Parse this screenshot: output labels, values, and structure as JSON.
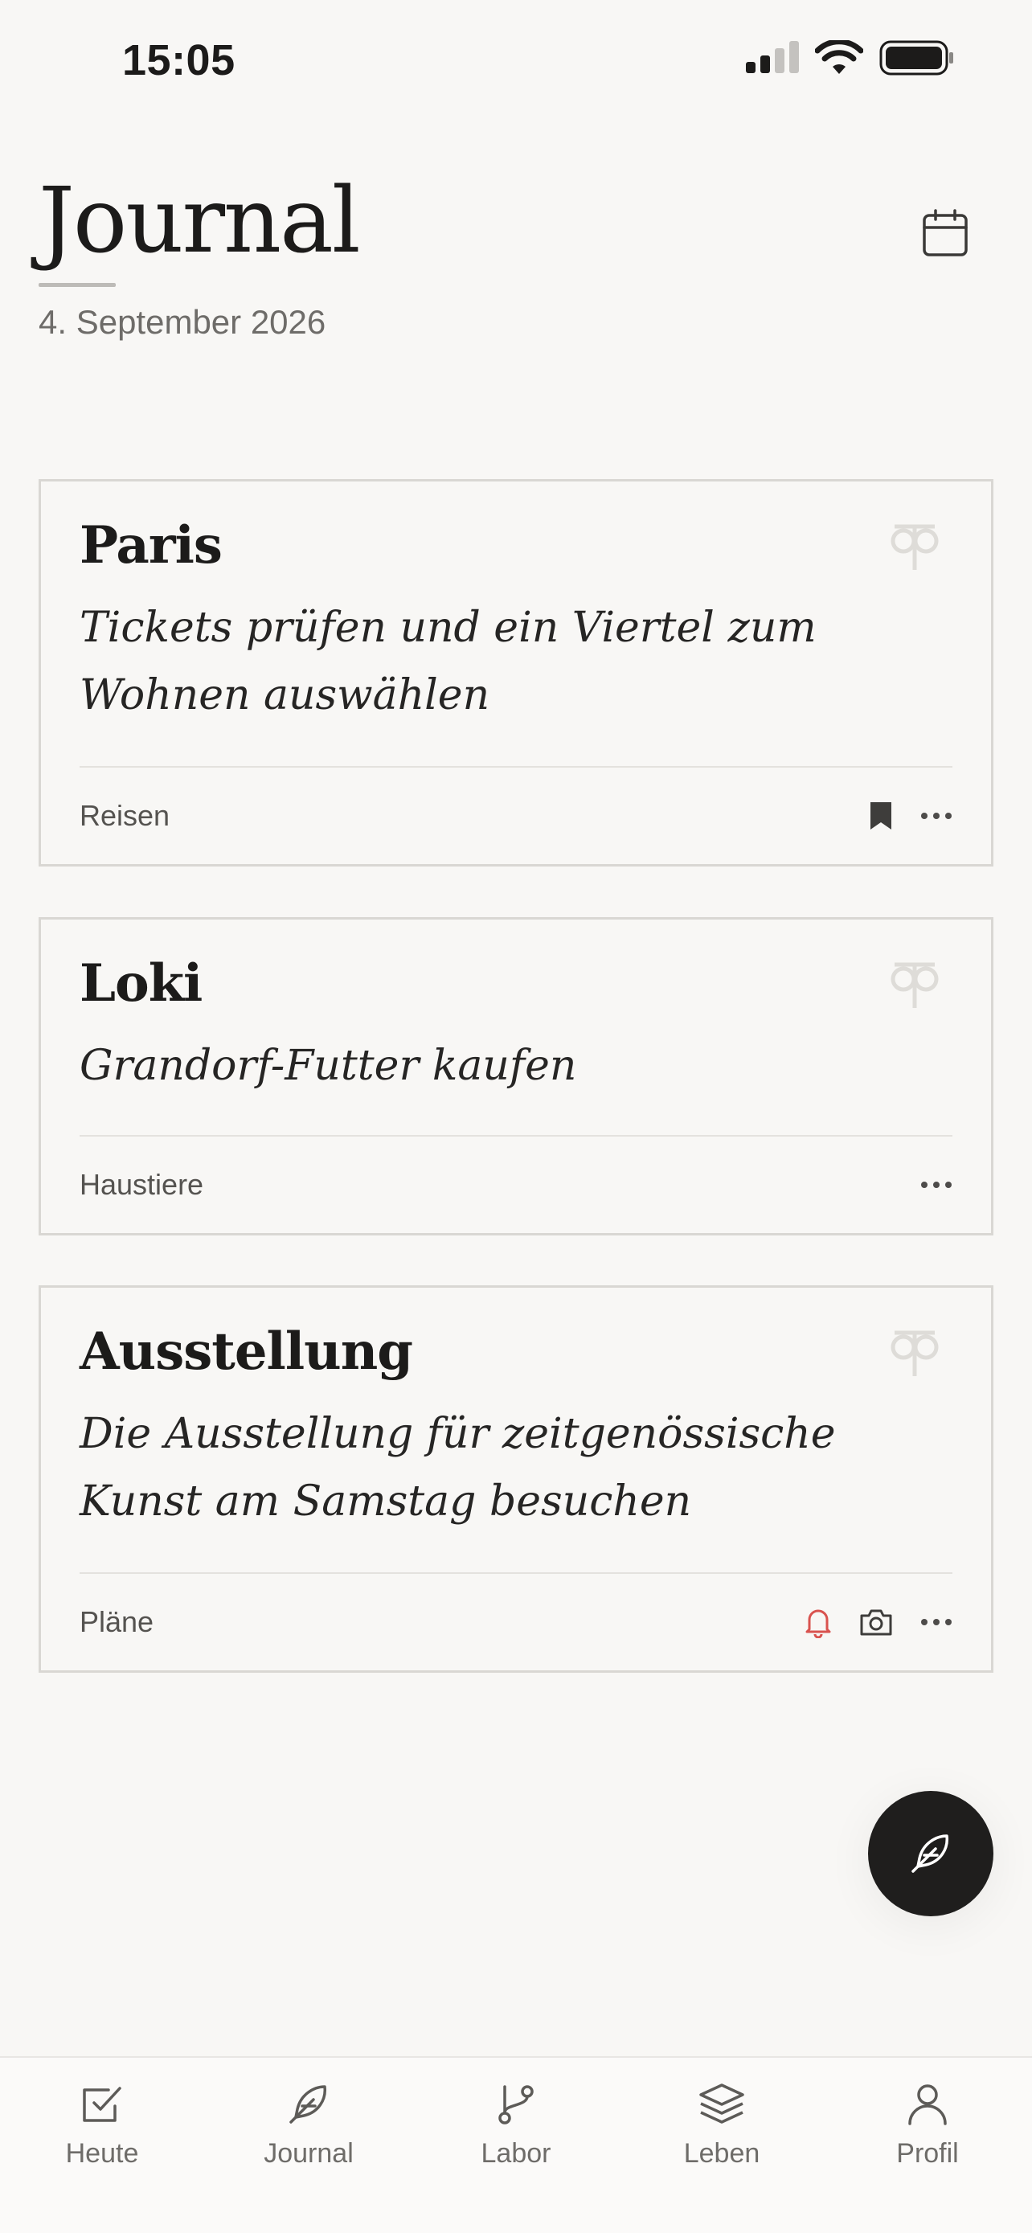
{
  "status_bar": {
    "time": "15:05",
    "icons": [
      "cellular-signal-icon",
      "wifi-icon",
      "battery-icon"
    ]
  },
  "header": {
    "title": "Journal",
    "date": "4. September 2026",
    "calendar_icon": "calendar-icon"
  },
  "cards": [
    {
      "title": "Paris",
      "text": "Tickets prüfen und ein Viertel zum Wohnen auswählen",
      "category": "Reisen",
      "icons": [
        "bookmark-icon",
        "more-icon"
      ]
    },
    {
      "title": "Loki",
      "text": "Grandorf-Futter kaufen",
      "category": "Haustiere",
      "icons": [
        "more-icon"
      ]
    },
    {
      "title": "Ausstellung",
      "text": "Die Ausstellung für zeitgenössische Kunst am Samstag besuchen",
      "category": "Pläne",
      "icons": [
        "bell-icon",
        "camera-icon",
        "more-icon"
      ]
    }
  ],
  "fab": {
    "icon": "feather-pen-icon"
  },
  "tabbar": {
    "items": [
      {
        "label": "Heute",
        "icon": "checkbox-icon"
      },
      {
        "label": "Journal",
        "icon": "feather-icon"
      },
      {
        "label": "Labor",
        "icon": "git-branch-icon"
      },
      {
        "label": "Leben",
        "icon": "layers-icon"
      },
      {
        "label": "Profil",
        "icon": "user-icon"
      }
    ]
  },
  "colors": {
    "background": "#f8f7f5",
    "text": "#1c1b1a",
    "muted": "#6e6c69",
    "alert": "#d9534f",
    "fab": "#1f1e1d"
  }
}
